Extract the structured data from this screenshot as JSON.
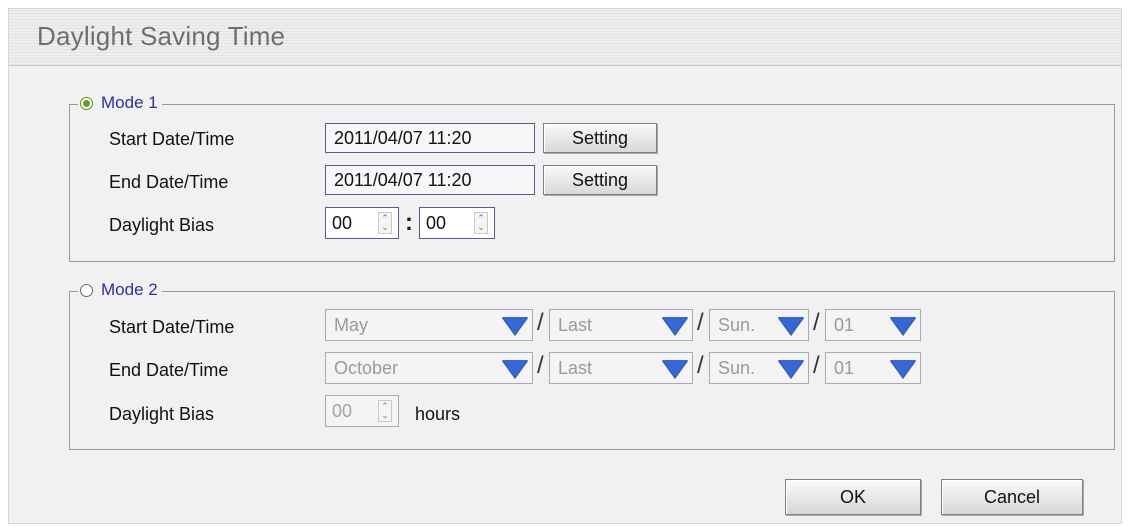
{
  "dialog": {
    "title": "Daylight Saving Time"
  },
  "mode1": {
    "label": "Mode 1",
    "selected": true,
    "start_label": "Start Date/Time",
    "start_value": "2011/04/07  11:20",
    "start_button": "Setting",
    "end_label": "End Date/Time",
    "end_value": "2011/04/07  11:20",
    "end_button": "Setting",
    "bias_label": "Daylight Bias",
    "bias_hours": "00",
    "bias_separator": ":",
    "bias_minutes": "00"
  },
  "mode2": {
    "label": "Mode 2",
    "selected": false,
    "start_label": "Start Date/Time",
    "start_month": "May",
    "start_week": "Last",
    "start_day": "Sun.",
    "start_hour": "01",
    "end_label": "End Date/Time",
    "end_month": "October",
    "end_week": "Last",
    "end_day": "Sun.",
    "end_hour": "01",
    "separator": "/",
    "bias_label": "Daylight Bias",
    "bias_value": "00",
    "bias_unit": "hours"
  },
  "buttons": {
    "ok": "OK",
    "cancel": "Cancel"
  },
  "colors": {
    "accent": "#2f2fa6",
    "dropdown_arrow": "#3567d6",
    "radio_selected": "#6a9a1e"
  },
  "icons": {
    "spin": "spin-arrows-icon",
    "dropdown": "triangle-down-icon"
  }
}
